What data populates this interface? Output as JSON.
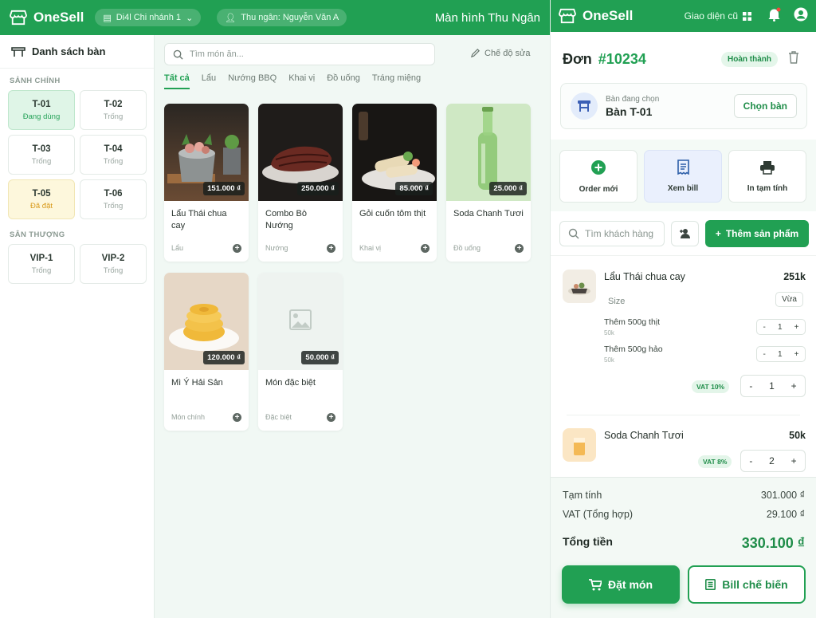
{
  "topbar": {
    "brand": "OneSell",
    "branch": "Di4l Chi nhánh 1",
    "cashier": "Thu ngân: Nguyễn Văn A",
    "screen_title": "Màn hình Thu Ngân"
  },
  "sidebar": {
    "title": "Danh sách bàn",
    "sections": [
      {
        "label": "SẢNH CHÍNH",
        "tables": [
          {
            "name": "T-01",
            "status": "Đang dùng",
            "state": "active"
          },
          {
            "name": "T-02",
            "status": "Trống",
            "state": "empty"
          },
          {
            "name": "T-03",
            "status": "Trống",
            "state": "empty"
          },
          {
            "name": "T-04",
            "status": "Trống",
            "state": "empty"
          },
          {
            "name": "T-05",
            "status": "Đã đặt",
            "state": "reserved"
          },
          {
            "name": "T-06",
            "status": "Trống",
            "state": "empty"
          }
        ]
      },
      {
        "label": "SÂN THƯỢNG",
        "tables": [
          {
            "name": "VIP-1",
            "status": "Trống",
            "state": "empty"
          },
          {
            "name": "VIP-2",
            "status": "Trống",
            "state": "empty"
          }
        ]
      }
    ]
  },
  "menu": {
    "search_placeholder": "Tìm món ăn...",
    "edit_mode": "Chế độ sửa",
    "tabs": [
      "Tất cả",
      "Lẩu",
      "Nướng BBQ",
      "Khai vị",
      "Đồ uống",
      "Tráng miệng"
    ],
    "active_tab": 0,
    "products": [
      {
        "name": "Lẩu Thái chua cay",
        "category": "Lẩu",
        "price": "151.000 ₫",
        "image": "hotpot"
      },
      {
        "name": "Combo Bò Nướng",
        "category": "Nướng",
        "price": "250.000 ₫",
        "image": "steak"
      },
      {
        "name": "Gỏi cuốn tôm thịt",
        "category": "Khai vị",
        "price": "85.000 ₫",
        "image": "rolls"
      },
      {
        "name": "Soda Chanh Tươi",
        "category": "Đồ uống",
        "price": "25.000 ₫",
        "image": "soda"
      },
      {
        "name": "Mì Ý Hải Sản",
        "category": "Món chính",
        "price": "120.000 ₫",
        "image": "pasta"
      },
      {
        "name": "Món đặc biệt",
        "category": "Đặc biệt",
        "price": "50.000 ₫",
        "image": "placeholder"
      }
    ]
  },
  "right": {
    "brand": "OneSell",
    "old_ui": "Giao diện cũ",
    "order_label": "Đơn",
    "order_number": "#10234",
    "status": "Hoàn thành",
    "table_caption": "Bàn đang chọn",
    "table_name": "Bàn T-01",
    "choose_table": "Chọn bàn",
    "actions": [
      {
        "label": "Order mới",
        "icon": "plus-circle-icon"
      },
      {
        "label": "Xem bill",
        "icon": "receipt-icon"
      },
      {
        "label": "In tạm tính",
        "icon": "printer-icon"
      }
    ],
    "customer_placeholder": "Tìm khách hàng",
    "add_product": "Thêm sản phẩm",
    "items": [
      {
        "name": "Lẩu Thái chua cay",
        "price": "251k",
        "size_label": "Size",
        "size_value": "Vừa",
        "options": [
          {
            "name": "Thêm 500g thịt",
            "price": "50k",
            "qty": "1"
          },
          {
            "name": "Thêm 500g hảo",
            "price": "50k",
            "qty": "1"
          }
        ],
        "vat": "VAT 10%",
        "qty": "1"
      },
      {
        "name": "Soda Chanh Tươi",
        "price": "50k",
        "vat": "VAT 8%",
        "qty": "2"
      }
    ],
    "totals": {
      "subtotal_label": "Tạm tính",
      "subtotal": "301.000 ₫",
      "vat_label": "VAT (Tổng hợp)",
      "vat": "29.100 ₫",
      "total_label": "Tổng tiền",
      "total": "330.100 ₫"
    },
    "place_order": "Đặt món",
    "kitchen_bill": "Bill chế biến"
  },
  "colors": {
    "accent": "#21a053",
    "accent_dark": "#1f8d49",
    "reserved": "#d89a1b"
  }
}
